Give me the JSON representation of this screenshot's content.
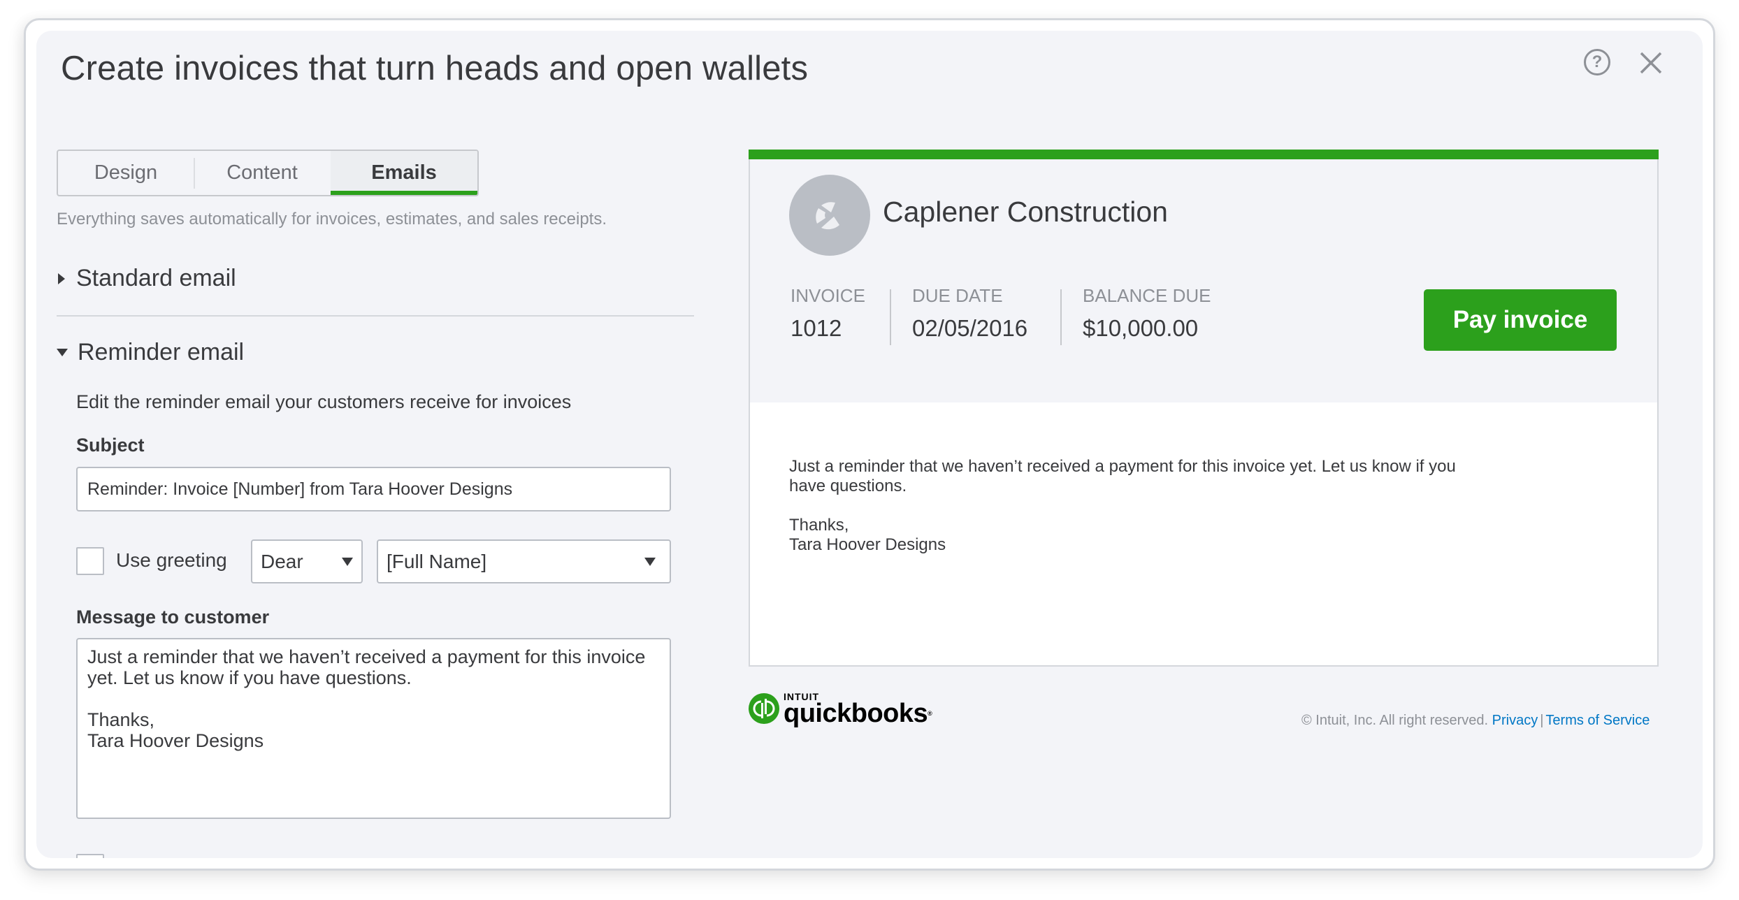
{
  "dialog": {
    "title": "Create invoices that turn heads and open wallets",
    "help_icon": "question-circle-icon",
    "close_icon": "close-x-icon"
  },
  "tabs": [
    {
      "label": "Design",
      "active": false
    },
    {
      "label": "Content",
      "active": false
    },
    {
      "label": "Emails",
      "active": true
    }
  ],
  "autosave_note": "Everything saves automatically for invoices, estimates, and sales receipts.",
  "sections": {
    "standard": {
      "label": "Standard email",
      "expanded": false
    },
    "reminder": {
      "label": "Reminder email",
      "expanded": true
    }
  },
  "reminder_form": {
    "description": "Edit the reminder email your customers receive for invoices",
    "subject_label": "Subject",
    "subject_value": "Reminder: Invoice [Number] from Tara Hoover Designs",
    "use_greeting_label": "Use greeting",
    "use_greeting_checked": false,
    "greeting_select": "Dear",
    "name_select": "[Full Name]",
    "message_label": "Message to customer",
    "message_value": "Just a reminder that we haven’t received a payment for this invoice\nyet. Let us know if you have questions.\n\nThanks,\nTara Hoover Designs"
  },
  "preview": {
    "accent_color": "#2ca01c",
    "company_name": "Caplener Construction",
    "invoice_label": "INVOICE",
    "invoice_value": "1012",
    "due_date_label": "DUE DATE",
    "due_date_value": "02/05/2016",
    "balance_label": "BALANCE DUE",
    "balance_value": "$10,000.00",
    "pay_button": "Pay invoice",
    "message": "Just a reminder that we haven’t received a payment for this invoice yet. Let us know if you\nhave questions.\n\nThanks,\nTara Hoover Designs"
  },
  "branding": {
    "intuit": "INTUIT",
    "quickbooks": "quickbooks",
    "reg": "®"
  },
  "footer": {
    "copyright": "© Intuit, Inc. All right reserved.",
    "privacy": "Privacy",
    "separator": "|",
    "terms": "Terms of Service"
  }
}
